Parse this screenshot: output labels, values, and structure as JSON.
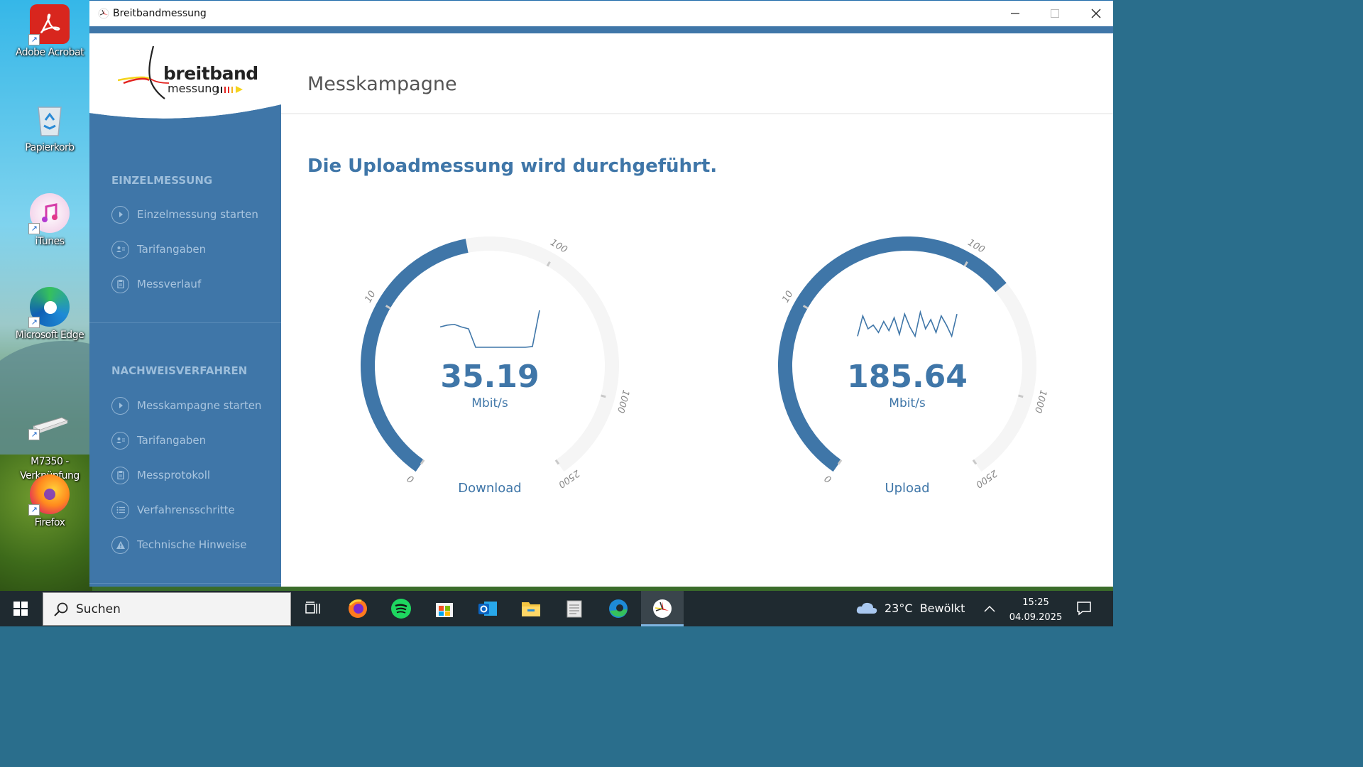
{
  "desktop": {
    "icons": [
      {
        "label": "Adobe Acrobat"
      },
      {
        "label": "Papierkorb"
      },
      {
        "label": "iTunes"
      },
      {
        "label": "Microsoft Edge"
      },
      {
        "label": "M7350 -\nVerknüpfung"
      },
      {
        "label": "Firefox"
      }
    ]
  },
  "window": {
    "title": "Breitbandmessung",
    "logo": {
      "line1": "breitband",
      "line2": "messung"
    },
    "sidebar": {
      "section1": {
        "title": "EINZELMESSUNG",
        "items": [
          {
            "label": "Einzelmessung starten",
            "icon": "play-icon"
          },
          {
            "label": "Tarifangaben",
            "icon": "user-card-icon"
          },
          {
            "label": "Messverlauf",
            "icon": "clipboard-icon"
          }
        ]
      },
      "section2": {
        "title": "NACHWEISVERFAHREN",
        "items": [
          {
            "label": "Messkampagne starten",
            "icon": "play-icon"
          },
          {
            "label": "Tarifangaben",
            "icon": "user-card-icon"
          },
          {
            "label": "Messprotokoll",
            "icon": "clipboard-icon"
          },
          {
            "label": "Verfahrensschritte",
            "icon": "list-icon"
          },
          {
            "label": "Technische Hinweise",
            "icon": "warning-icon"
          }
        ]
      }
    },
    "main": {
      "page_title": "Messkampagne",
      "status": "Die Uploadmessung wird durchgeführt."
    },
    "gauges": [
      {
        "name": "Download",
        "value": "35.19",
        "numeric": 35.19,
        "unit": "Mbit/s",
        "ticks": [
          "0",
          "10",
          "100",
          "1000",
          "2500"
        ],
        "sparkline": [
          0.55,
          0.6,
          0.62,
          0.55,
          0.5,
          0.0,
          0.0,
          0.0,
          0.0,
          0.0,
          0.0,
          0.0,
          0.0,
          0.02,
          1.0
        ]
      },
      {
        "name": "Upload",
        "value": "185.64",
        "numeric": 185.64,
        "unit": "Mbit/s",
        "ticks": [
          "0",
          "10",
          "100",
          "1000",
          "2500"
        ],
        "sparkline": [
          0.3,
          0.85,
          0.5,
          0.6,
          0.4,
          0.7,
          0.45,
          0.8,
          0.35,
          0.9,
          0.55,
          0.3,
          0.95,
          0.5,
          0.75,
          0.4,
          0.85,
          0.6,
          0.3,
          0.9
        ]
      }
    ]
  },
  "colors": {
    "accent": "#3f76a8",
    "gauge_track": "#f5f5f5",
    "text_muted": "#a9c5df"
  },
  "taskbar": {
    "search_placeholder": "Suchen",
    "weather": "23°C  Bewölkt",
    "time": "15:25",
    "date": "04.09.2025"
  }
}
